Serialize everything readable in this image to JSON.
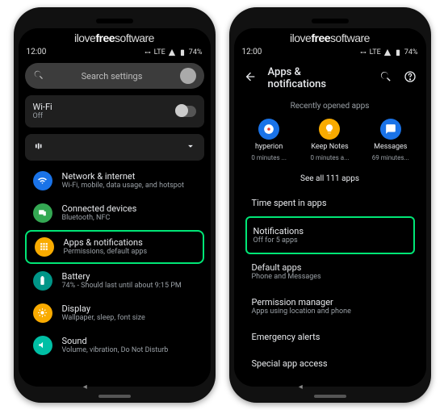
{
  "brand_parts": [
    "ilove",
    "free",
    "software"
  ],
  "status": {
    "time": "12:00",
    "net": "LTE",
    "battery": "74%"
  },
  "left": {
    "search_placeholder": "Search settings",
    "wifi": {
      "label": "Wi-Fi",
      "status": "Off"
    },
    "items": [
      {
        "title": "Network & internet",
        "sub": "Wi-Fi, mobile, data usage, and hotspot",
        "color": "#1a73e8",
        "icon": "wifi",
        "hl": false
      },
      {
        "title": "Connected devices",
        "sub": "Bluetooth, NFC",
        "color": "#34a853",
        "icon": "devices",
        "hl": false
      },
      {
        "title": "Apps & notifications",
        "sub": "Permissions, default apps",
        "color": "#f9ab00",
        "icon": "apps",
        "hl": true
      },
      {
        "title": "Battery",
        "sub": "74% - Should last until about 9:15 PM",
        "color": "#009688",
        "icon": "battery",
        "hl": false
      },
      {
        "title": "Display",
        "sub": "Wallpaper, sleep, font size",
        "color": "#f9ab00",
        "icon": "display",
        "hl": false
      },
      {
        "title": "Sound",
        "sub": "Volume, vibration, Do Not Disturb",
        "color": "#00bfa5",
        "icon": "sound",
        "hl": false
      }
    ]
  },
  "right": {
    "header": "Apps & notifications",
    "recent_label": "Recently opened apps",
    "apps": [
      {
        "name": "hyperion",
        "sub": "0 minutes ...",
        "color": "#1a73e8",
        "icon": "circle-dot"
      },
      {
        "name": "Keep Notes",
        "sub": "0 minutes a...",
        "color": "#f9ab00",
        "icon": "bulb"
      },
      {
        "name": "Messages",
        "sub": "69 minutes...",
        "color": "#1a73e8",
        "icon": "message"
      }
    ],
    "see_all": "See all 111 apps",
    "rows": [
      {
        "title": "Time spent in apps",
        "sub": "",
        "hl": false
      },
      {
        "title": "Notifications",
        "sub": "Off for 5 apps",
        "hl": true
      },
      {
        "title": "Default apps",
        "sub": "Phone and Messages",
        "hl": false
      },
      {
        "title": "Permission manager",
        "sub": "Apps using location and phone",
        "hl": false
      },
      {
        "title": "Emergency alerts",
        "sub": "",
        "hl": false
      },
      {
        "title": "Special app access",
        "sub": "",
        "hl": false
      }
    ]
  }
}
